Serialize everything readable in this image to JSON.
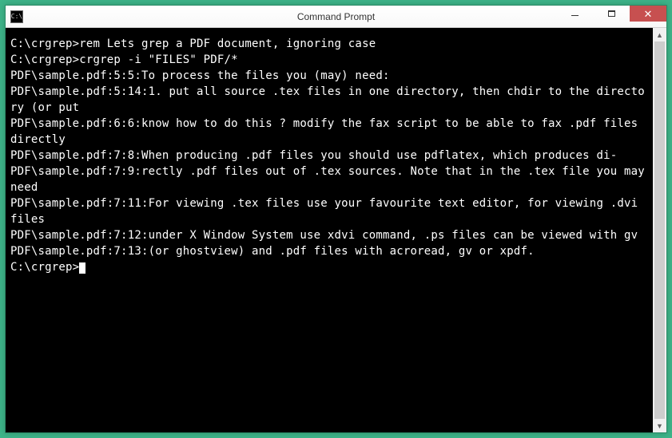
{
  "window": {
    "title": "Command Prompt",
    "icon_label": "C:\\"
  },
  "terminal": {
    "lines": [
      "",
      "C:\\crgrep>rem Lets grep a PDF document, ignoring case",
      "",
      "C:\\crgrep>crgrep -i \"FILES\" PDF/*",
      "PDF\\sample.pdf:5:5:To process the files you (may) need:",
      "PDF\\sample.pdf:5:14:1. put all source .tex files in one directory, then chdir to the directory (or put",
      "PDF\\sample.pdf:6:6:know how to do this ? modify the fax script to be able to fax .pdf files directly",
      "PDF\\sample.pdf:7:8:When producing .pdf files you should use pdflatex, which produces di-",
      "PDF\\sample.pdf:7:9:rectly .pdf files out of .tex sources. Note that in the .tex file you may need",
      "PDF\\sample.pdf:7:11:For viewing .tex files use your favourite text editor, for viewing .dvi files",
      "PDF\\sample.pdf:7:12:under X Window System use xdvi command, .ps files can be viewed with gv",
      "PDF\\sample.pdf:7:13:(or ghostview) and .pdf files with acroread, gv or xpdf.",
      "",
      "C:\\crgrep>"
    ]
  }
}
